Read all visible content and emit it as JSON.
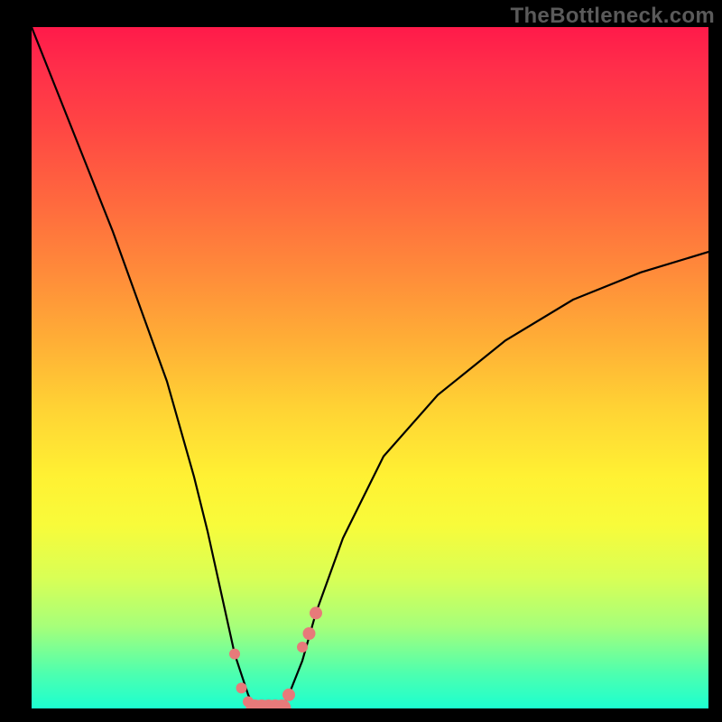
{
  "watermark": "TheBottleneck.com",
  "chart_data": {
    "type": "line",
    "title": "",
    "xlabel": "",
    "ylabel": "",
    "xlim": [
      0,
      100
    ],
    "ylim": [
      0,
      100
    ],
    "series": [
      {
        "name": "bottleneck-curve",
        "x": [
          0,
          4,
          8,
          12,
          16,
          20,
          24,
          26,
          28,
          30,
          32,
          33,
          34,
          35,
          36,
          37,
          38,
          40,
          42,
          46,
          52,
          60,
          70,
          80,
          90,
          100
        ],
        "values": [
          100,
          90,
          80,
          70,
          59,
          48,
          34,
          26,
          17,
          8,
          2,
          0,
          0,
          0,
          0,
          0,
          2,
          7,
          14,
          25,
          37,
          46,
          54,
          60,
          64,
          67
        ]
      }
    ],
    "markers": {
      "name": "highlight-points",
      "color": "#e77a7a",
      "x": [
        30,
        31,
        32,
        33,
        34,
        35,
        36,
        37,
        38,
        40,
        41,
        42
      ],
      "values": [
        8,
        3,
        1,
        0,
        0,
        0,
        0,
        0,
        2,
        9,
        11,
        14
      ],
      "radius": [
        6,
        6,
        6,
        10,
        10,
        10,
        10,
        10,
        7,
        6,
        7,
        7
      ]
    },
    "background_gradient": {
      "direction": "vertical",
      "stops": [
        {
          "pos": 0.0,
          "color": "#ff1a4a"
        },
        {
          "pos": 0.26,
          "color": "#ff6a3e"
        },
        {
          "pos": 0.56,
          "color": "#ffd334"
        },
        {
          "pos": 0.73,
          "color": "#f8fb3a"
        },
        {
          "pos": 1.0,
          "color": "#1cffd0"
        }
      ]
    }
  }
}
